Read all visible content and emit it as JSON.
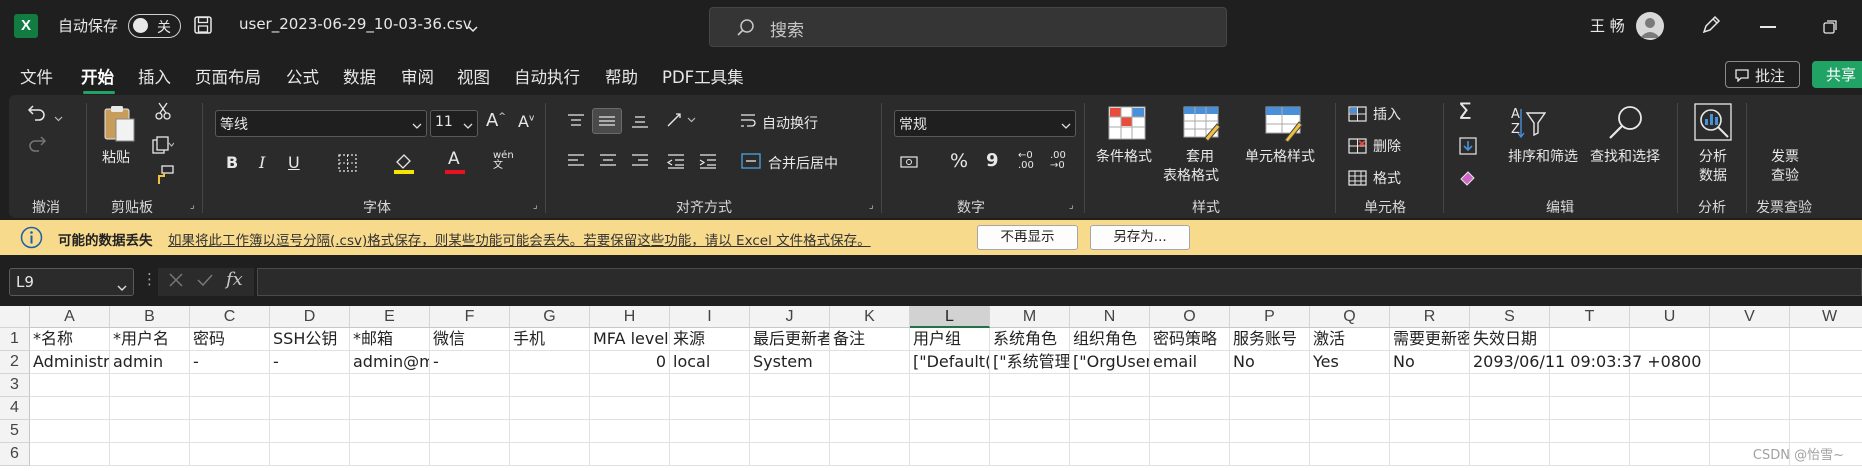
{
  "titlebar": {
    "app_letter": "X",
    "autosave_label": "自动保存",
    "autosave_state": "关",
    "filename": "user_2023-06-29_10-03-36.csv",
    "search_placeholder": "搜索",
    "user_name": "王 畅"
  },
  "menu": [
    "文件",
    "开始",
    "插入",
    "页面布局",
    "公式",
    "数据",
    "审阅",
    "视图",
    "自动执行",
    "帮助",
    "PDF工具集"
  ],
  "menu_active": "开始",
  "comment_button": "批注",
  "share_button": "共享",
  "ribbon": {
    "groups": {
      "undo": "撤消",
      "clipboard": "剪贴板",
      "font": "字体",
      "alignment": "对齐方式",
      "number": "数字",
      "styles": "样式",
      "cells": "单元格",
      "editing": "编辑",
      "analysis": "分析",
      "invoice": "发票查验"
    },
    "paste": "粘贴",
    "font_name": "等线",
    "font_size": "11",
    "wrap_text": "自动换行",
    "merge_center": "合并后居中",
    "number_format": "常规",
    "conditional_format": "条件格式",
    "format_table_1": "套用",
    "format_table_2": "表格格式",
    "cell_styles": "单元格样式",
    "insert": "插入",
    "delete": "删除",
    "format": "格式",
    "sort_filter": "排序和筛选",
    "find_select": "查找和选择",
    "analyze_1": "分析",
    "analyze_2": "数据",
    "invoice_1": "发票",
    "invoice_2": "查验"
  },
  "infobar": {
    "title": "可能的数据丢失",
    "message": "如果将此工作簿以逗号分隔(.csv)格式保存，则某些功能可能会丢失。若要保留这些功能，请以 Excel 文件格式保存。",
    "btn_dont_show": "不再显示",
    "btn_save_as": "另存为..."
  },
  "formula_bar": {
    "name_box": "L9",
    "fx": "fx",
    "value": ""
  },
  "sheet": {
    "columns": [
      "A",
      "B",
      "C",
      "D",
      "E",
      "F",
      "G",
      "H",
      "I",
      "J",
      "K",
      "L",
      "M",
      "N",
      "O",
      "P",
      "Q",
      "R",
      "S",
      "T",
      "U",
      "V",
      "W"
    ],
    "selected_column": "L",
    "row_numbers": [
      "1",
      "2",
      "3",
      "4",
      "5",
      "6"
    ],
    "header_row": [
      "*名称",
      "*用户名",
      "密码",
      "SSH公钥",
      "*邮箱",
      "微信",
      "手机",
      "MFA level",
      "来源",
      "最后更新者",
      "备注",
      "用户组",
      "系统角色",
      "组织角色",
      "密码策略",
      "服务账号",
      "激活",
      "需要更新密码",
      "失效日期",
      "",
      "",
      "",
      ""
    ],
    "data_row": [
      "Administrator",
      "admin",
      "-",
      "-",
      "admin@mycomany.com",
      "-",
      "",
      "0",
      "local",
      "System",
      "",
      "[\"Default(a",
      "[\"系统管理员",
      "[\"OrgUser",
      "email",
      "No",
      "Yes",
      "No",
      "2093/06/11 09:03:37 +0800",
      "",
      "",
      "",
      ""
    ]
  },
  "watermark": "CSDN @怡雪~"
}
